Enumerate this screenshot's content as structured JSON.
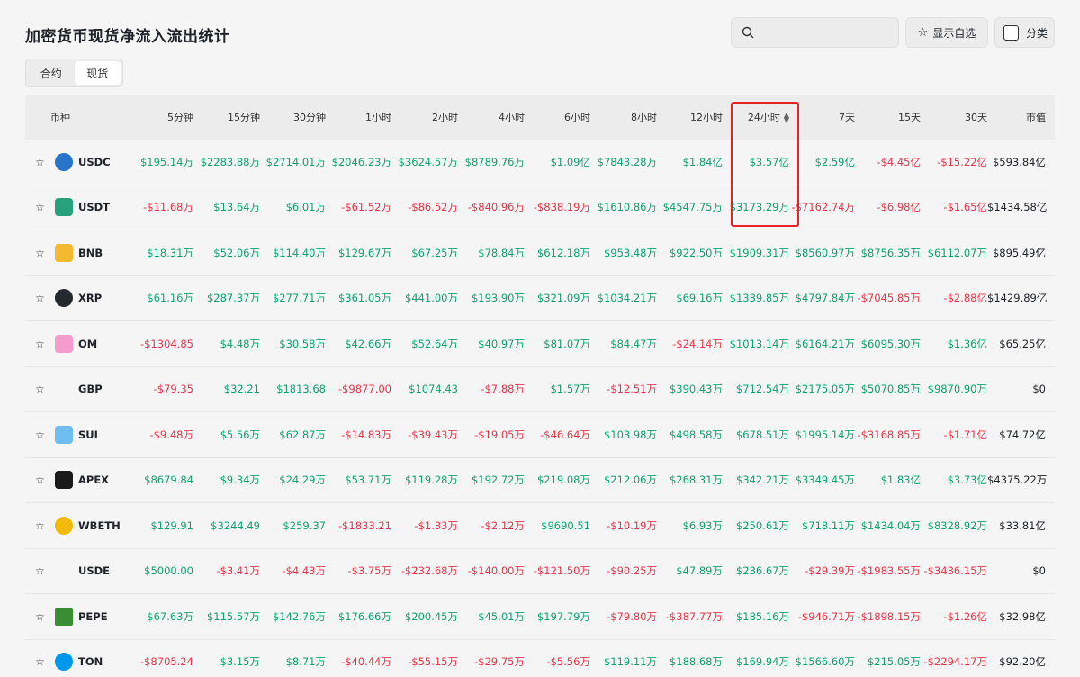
{
  "header": {
    "title": "加密货币现货净流入流出统计",
    "search_placeholder": "",
    "fav_label": "显示自选",
    "category_label": "分类"
  },
  "tabs": [
    {
      "label": "合约",
      "active": false
    },
    {
      "label": "现货",
      "active": true
    }
  ],
  "columns": [
    "币种",
    "5分钟",
    "15分钟",
    "30分钟",
    "1小时",
    "2小时",
    "4小时",
    "6小时",
    "8小时",
    "12小时",
    "24小时",
    "7天",
    "15天",
    "30天",
    "市值"
  ],
  "sorted_column": "24小时",
  "colors": {
    "positive": "#0ea371",
    "negative": "#e8374b",
    "highlight": "#e8202a"
  },
  "rows": [
    {
      "coin": "USDC",
      "icon": "usdc-icon",
      "values": [
        "$195.14万",
        "$2283.88万",
        "$2714.01万",
        "$2046.23万",
        "$3624.57万",
        "$8789.76万",
        "$1.09亿",
        "$7843.28万",
        "$1.84亿",
        "$3.57亿",
        "$2.59亿",
        "-$4.45亿",
        "-$15.22亿",
        "$593.84亿"
      ]
    },
    {
      "coin": "USDT",
      "icon": "usdt-icon",
      "values": [
        "-$11.68万",
        "$13.64万",
        "$6.01万",
        "-$61.52万",
        "-$86.52万",
        "-$840.96万",
        "-$838.19万",
        "$1610.86万",
        "$4547.75万",
        "$3173.29万",
        "-$7162.74万",
        "-$6.98亿",
        "-$1.65亿",
        "$1434.58亿"
      ]
    },
    {
      "coin": "BNB",
      "icon": "bnb-icon",
      "values": [
        "$18.31万",
        "$52.06万",
        "$114.40万",
        "$129.67万",
        "$67.25万",
        "$78.84万",
        "$612.18万",
        "$953.48万",
        "$922.50万",
        "$1909.31万",
        "$8560.97万",
        "$8756.35万",
        "$6112.07万",
        "$895.49亿"
      ]
    },
    {
      "coin": "XRP",
      "icon": "xrp-icon",
      "values": [
        "$61.16万",
        "$287.37万",
        "$277.71万",
        "$361.05万",
        "$441.00万",
        "$193.90万",
        "$321.09万",
        "$1034.21万",
        "$69.16万",
        "$1339.85万",
        "$4797.84万",
        "-$7045.85万",
        "-$2.88亿",
        "$1429.89亿"
      ]
    },
    {
      "coin": "OM",
      "icon": "om-icon",
      "values": [
        "-$1304.85",
        "$4.48万",
        "$30.58万",
        "$42.66万",
        "$52.64万",
        "$40.97万",
        "$81.07万",
        "$84.47万",
        "-$24.14万",
        "$1013.14万",
        "$6164.21万",
        "$6095.30万",
        "$1.36亿",
        "$65.25亿"
      ]
    },
    {
      "coin": "GBP",
      "icon": "",
      "values": [
        "-$79.35",
        "$32.21",
        "$1813.68",
        "-$9877.00",
        "$1074.43",
        "-$7.88万",
        "$1.57万",
        "-$12.51万",
        "$390.43万",
        "$712.54万",
        "$2175.05万",
        "$5070.85万",
        "$9870.90万",
        "$0"
      ]
    },
    {
      "coin": "SUI",
      "icon": "sui-icon",
      "values": [
        "-$9.48万",
        "$5.56万",
        "$62.87万",
        "-$14.83万",
        "-$39.43万",
        "-$19.05万",
        "-$46.64万",
        "$103.98万",
        "$498.58万",
        "$678.51万",
        "$1995.14万",
        "-$3168.85万",
        "-$1.71亿",
        "$74.72亿"
      ]
    },
    {
      "coin": "APEX",
      "icon": "apex-icon",
      "values": [
        "$8679.84",
        "$9.34万",
        "$24.29万",
        "$53.71万",
        "$119.28万",
        "$192.72万",
        "$219.08万",
        "$212.06万",
        "$268.31万",
        "$342.21万",
        "$3349.45万",
        "$1.83亿",
        "$3.73亿",
        "$4375.22万"
      ]
    },
    {
      "coin": "WBETH",
      "icon": "wbeth-icon",
      "values": [
        "$129.91",
        "$3244.49",
        "$259.37",
        "-$1833.21",
        "-$1.33万",
        "-$2.12万",
        "$9690.51",
        "-$10.19万",
        "$6.93万",
        "$250.61万",
        "$718.11万",
        "$1434.04万",
        "$8328.92万",
        "$33.81亿"
      ]
    },
    {
      "coin": "USDE",
      "icon": "",
      "values": [
        "$5000.00",
        "-$3.41万",
        "-$4.43万",
        "-$3.75万",
        "-$232.68万",
        "-$140.00万",
        "-$121.50万",
        "-$90.25万",
        "$47.89万",
        "$236.67万",
        "-$29.39万",
        "-$1983.55万",
        "-$3436.15万",
        "$0"
      ]
    },
    {
      "coin": "PEPE",
      "icon": "pepe-icon",
      "values": [
        "$67.63万",
        "$115.57万",
        "$142.76万",
        "$176.66万",
        "$200.45万",
        "$45.01万",
        "$197.79万",
        "-$79.80万",
        "-$387.77万",
        "$185.16万",
        "-$946.71万",
        "-$1898.15万",
        "-$1.26亿",
        "$32.98亿"
      ]
    },
    {
      "coin": "TON",
      "icon": "ton-icon",
      "values": [
        "-$8705.24",
        "$3.15万",
        "$8.71万",
        "-$40.44万",
        "-$55.15万",
        "-$29.75万",
        "-$5.56万",
        "$119.11万",
        "$188.68万",
        "$169.94万",
        "$1566.60万",
        "$215.05万",
        "-$2294.17万",
        "$92.20亿"
      ]
    }
  ]
}
